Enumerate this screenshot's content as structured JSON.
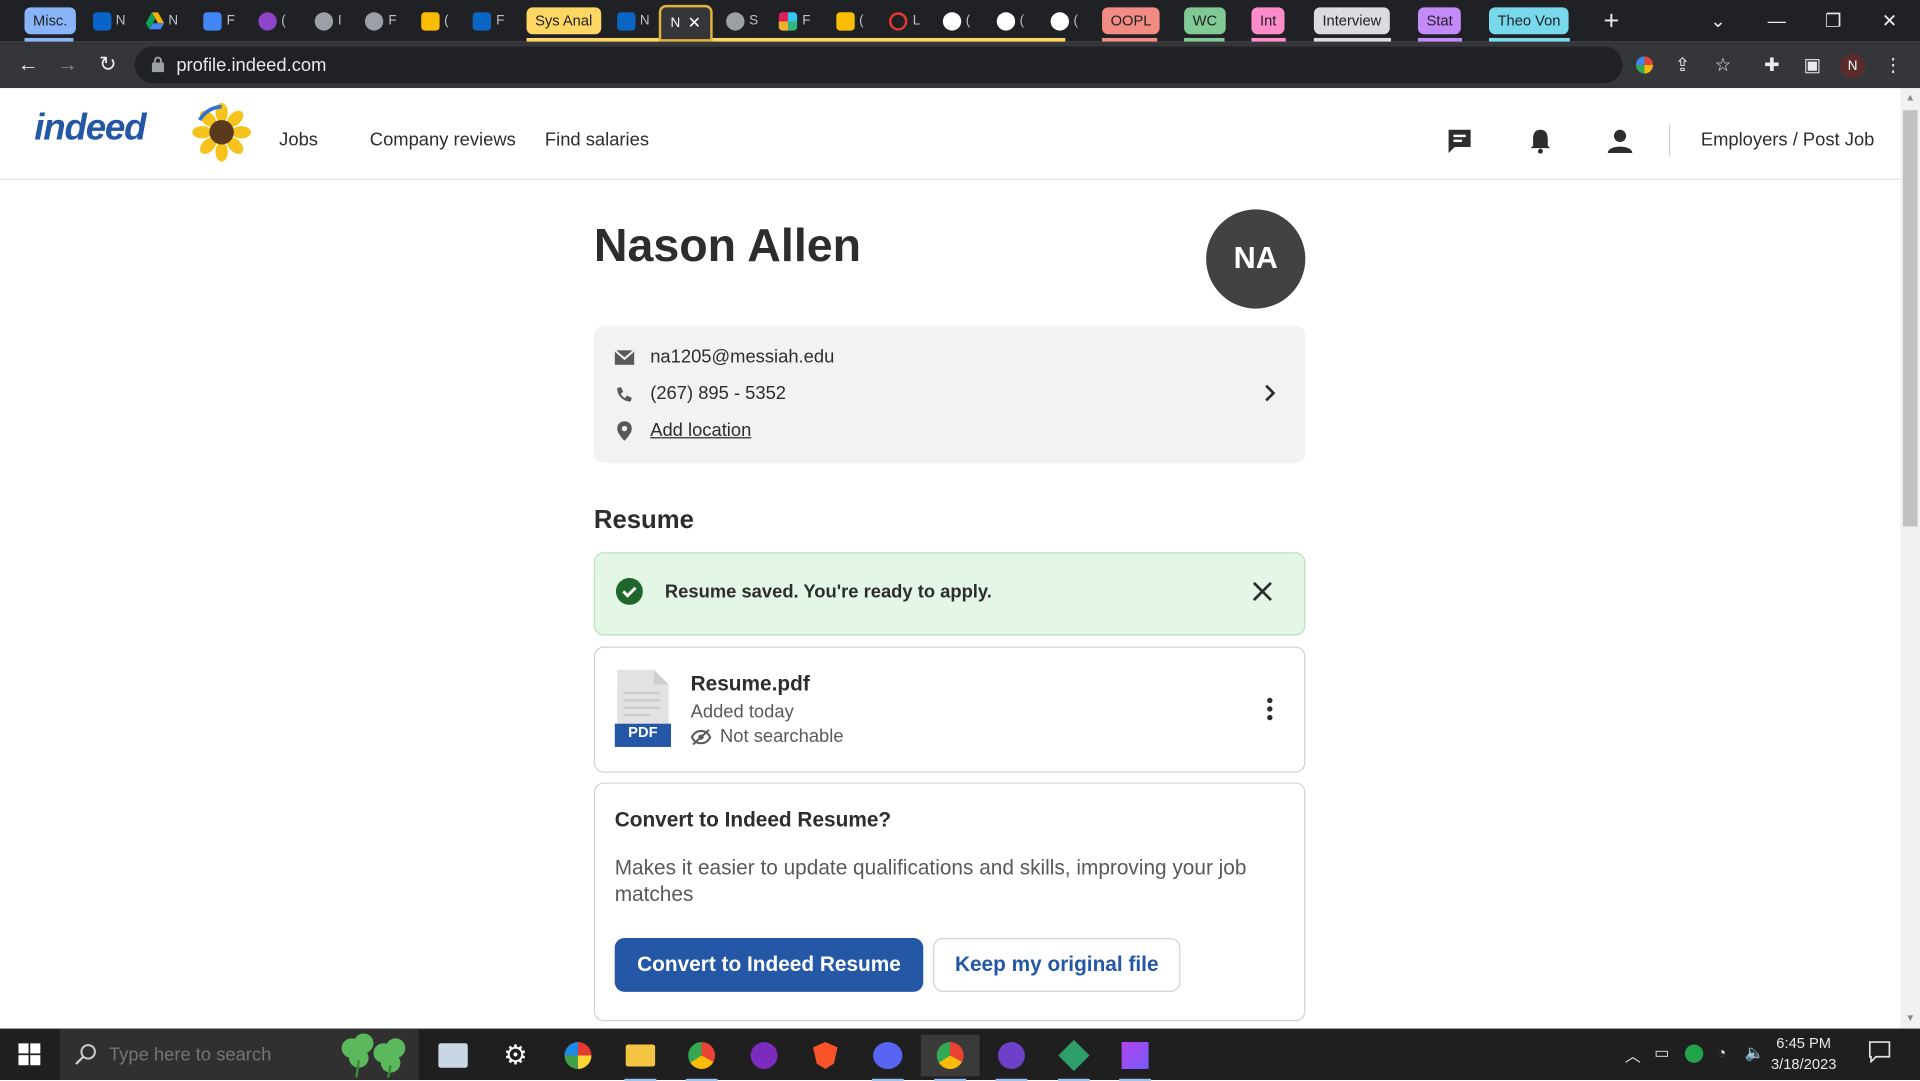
{
  "browser": {
    "tabs": [
      {
        "kind": "group",
        "label": "Misc.",
        "color": "#8ab4f8"
      },
      {
        "kind": "tab",
        "char": "N",
        "icon": "outlook-icon",
        "color": "#0a64c8"
      },
      {
        "kind": "tab",
        "char": "N",
        "icon": "google-drive-icon",
        "color": "#f4b400"
      },
      {
        "kind": "tab",
        "char": "F",
        "icon": "google-docs-icon",
        "color": "#4285f4"
      },
      {
        "kind": "tab",
        "char": "(",
        "icon": "u-app-icon",
        "color": "#8e44c9"
      },
      {
        "kind": "tab",
        "char": "I",
        "icon": "globe-icon",
        "color": "#9aa0a6"
      },
      {
        "kind": "tab",
        "char": "F",
        "icon": "globe-icon",
        "color": "#9aa0a6"
      },
      {
        "kind": "tab",
        "char": "(",
        "icon": "keep-icon",
        "color": "#fbbc04"
      },
      {
        "kind": "tab",
        "char": "F",
        "icon": "linkedin-icon",
        "color": "#0a66c2"
      },
      {
        "kind": "group",
        "label": "Sys Anal",
        "color": "#fdd663"
      },
      {
        "kind": "tab",
        "char": "N",
        "icon": "linkedin-icon",
        "color": "#0a66c2"
      },
      {
        "kind": "tab",
        "char": "N",
        "icon": "indeed-icon",
        "color": "#ffffff",
        "active": true
      },
      {
        "kind": "tab",
        "char": "S",
        "icon": "globe-icon",
        "color": "#9aa0a6"
      },
      {
        "kind": "tab",
        "char": "F",
        "icon": "slack-icon",
        "color": "#e01e5a"
      },
      {
        "kind": "tab",
        "char": "(",
        "icon": "keep-icon",
        "color": "#fbbc04"
      },
      {
        "kind": "tab",
        "char": "L",
        "icon": "red-target-icon",
        "color": "#e53935"
      },
      {
        "kind": "tab",
        "char": "(",
        "icon": "github-icon",
        "color": "#ffffff"
      },
      {
        "kind": "tab",
        "char": "(",
        "icon": "github-icon",
        "color": "#ffffff"
      },
      {
        "kind": "tab",
        "char": "(",
        "icon": "github-icon",
        "color": "#ffffff"
      },
      {
        "kind": "group",
        "label": "OOPL",
        "color": "#f28b82"
      },
      {
        "kind": "group",
        "label": "WC",
        "color": "#81c995"
      },
      {
        "kind": "group",
        "label": "Int",
        "color": "#ff8bcb"
      },
      {
        "kind": "group",
        "label": "Interview",
        "color": "#dadce0"
      },
      {
        "kind": "group",
        "label": "Stat",
        "color": "#c58af9"
      },
      {
        "kind": "group",
        "label": "Theo Von",
        "color": "#78d9ec"
      }
    ],
    "url": "profile.indeed.com",
    "profile_initial": "N"
  },
  "site": {
    "logo": "indeed",
    "nav": [
      "Jobs",
      "Company reviews",
      "Find salaries"
    ],
    "employers_link": "Employers / Post Job"
  },
  "profile": {
    "name": "Nason Allen",
    "initials": "NA",
    "email": "na1205@messiah.edu",
    "phone": "(267) 895 - 5352",
    "location_link": "Add location"
  },
  "resume": {
    "heading": "Resume",
    "alert": "Resume saved. You're ready to apply.",
    "file_name": "Resume.pdf",
    "file_badge": "PDF",
    "added": "Added today",
    "visibility": "Not searchable"
  },
  "convert": {
    "title": "Convert to Indeed Resume?",
    "description": "Makes it easier to update qualifications and skills, improving your job matches",
    "primary_button": "Convert to Indeed Resume",
    "secondary_button": "Keep my original file"
  },
  "taskbar": {
    "search_placeholder": "Type here to search",
    "time": "6:45 PM",
    "date": "3/18/2023",
    "apps": [
      "file-explorer-like-icon",
      "settings-icon",
      "paint-icon",
      "file-explorer-icon",
      "chrome-icon",
      "podcast-icon",
      "brave-icon",
      "discord-icon",
      "chrome-profile-icon",
      "github-desktop-icon",
      "git-icon",
      "phpstorm-icon"
    ]
  }
}
